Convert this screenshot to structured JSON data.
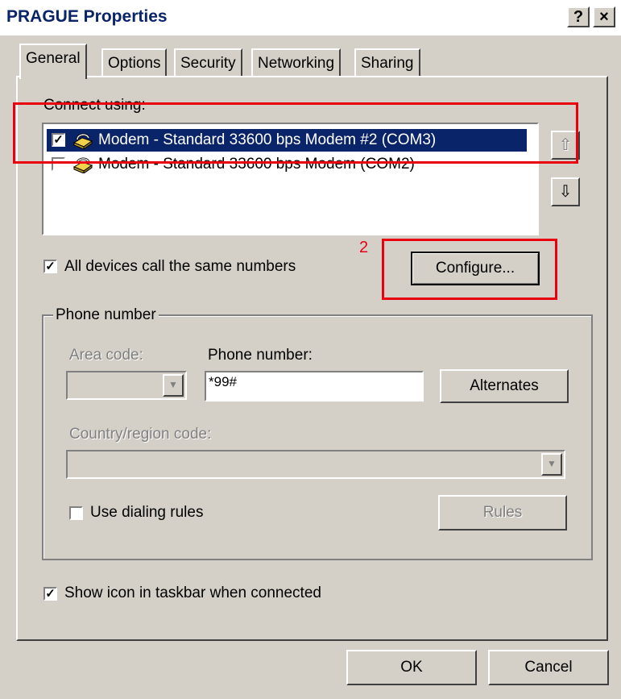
{
  "window": {
    "title": "PRAGUE Properties",
    "help_btn": "?",
    "close_btn": "×"
  },
  "tabs": [
    "General",
    "Options",
    "Security",
    "Networking",
    "Sharing"
  ],
  "connect": {
    "label": "Connect using:",
    "devices": [
      {
        "label": "Modem - Standard 33600 bps Modem #2 (COM3)",
        "checked": true,
        "selected": true
      },
      {
        "label": "Modem - Standard 33600 bps Modem (COM2)",
        "checked": false,
        "selected": false
      }
    ],
    "up_icon": "move-up-icon",
    "down_icon": "move-down-icon",
    "up_glyph": "⇧",
    "down_glyph": "⇩"
  },
  "annotation": {
    "number": "2",
    "color": "#e8000f"
  },
  "all_devices": {
    "label": "All devices call the same numbers",
    "checked": true
  },
  "configure_btn": "Configure...",
  "phone": {
    "group_label": "Phone number",
    "area_code_label": "Area code:",
    "phone_number_label": "Phone number:",
    "phone_number_value": "*99#",
    "alternates_btn": "Alternates",
    "country_label": "Country/region code:",
    "dialing_rules_label": "Use dialing rules",
    "dialing_rules_checked": false,
    "rules_btn": "Rules"
  },
  "show_icon": {
    "label": "Show icon in taskbar when connected",
    "checked": true
  },
  "footer": {
    "ok": "OK",
    "cancel": "Cancel"
  },
  "colors": {
    "selection": "#0a246a",
    "face": "#d4d0c8",
    "title_text": "#0a246a"
  }
}
